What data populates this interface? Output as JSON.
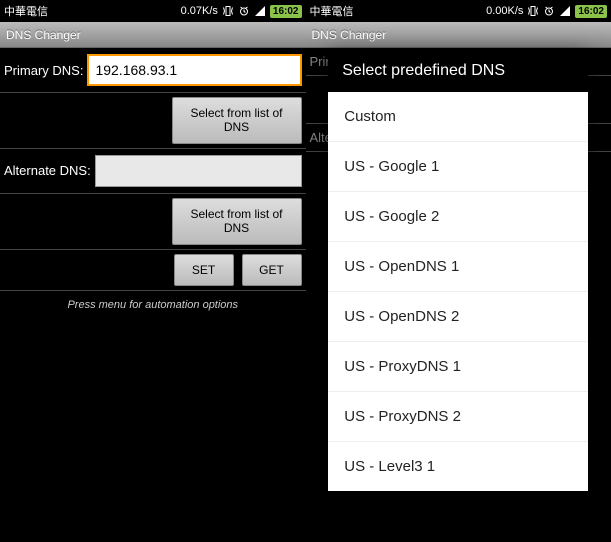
{
  "status": {
    "carrier": "中華電信",
    "speed_left": "0.07K/s",
    "speed_right": "0.00K/s",
    "battery": "16:02",
    "time": "16:02"
  },
  "app": {
    "title": "DNS Changer"
  },
  "fields": {
    "primary_label": "Primary DNS:",
    "primary_value": "192.168.93.1",
    "alternate_label": "Alternate DNS:",
    "alternate_value": "",
    "select_btn": "Select from list of DNS",
    "set_btn": "SET",
    "get_btn": "GET",
    "hint": "Press menu for automation options"
  },
  "dialog": {
    "title": "Select predefined DNS",
    "items": [
      "Custom",
      "US - Google 1",
      "US - Google 2",
      "US - OpenDNS 1",
      "US - OpenDNS 2",
      "US - ProxyDNS 1",
      "US - ProxyDNS 2",
      "US - Level3 1"
    ]
  },
  "right_screen": {
    "primary_label_partial": "Prima",
    "alternate_label_partial": "Alter"
  }
}
